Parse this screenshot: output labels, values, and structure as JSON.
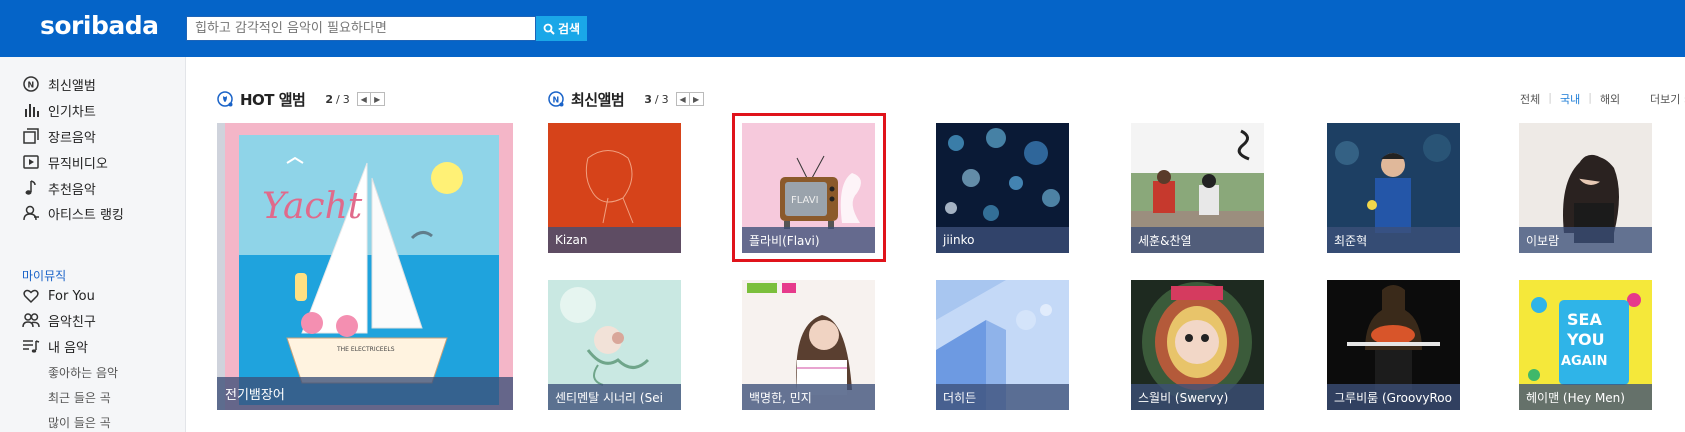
{
  "header": {
    "logo": "soribada",
    "search_placeholder": "힙하고 감각적인 음악이 필요하다면",
    "search_button": "검색"
  },
  "sidebar": {
    "items": [
      {
        "label": "최신앨범",
        "icon": "new-album-icon"
      },
      {
        "label": "인기차트",
        "icon": "chart-icon"
      },
      {
        "label": "장르음악",
        "icon": "genre-icon"
      },
      {
        "label": "뮤직비디오",
        "icon": "video-icon"
      },
      {
        "label": "추천음악",
        "icon": "music-note-icon"
      },
      {
        "label": "아티스트 랭킹",
        "icon": "artist-icon"
      }
    ],
    "my_music_title": "마이뮤직",
    "my_items": [
      {
        "label": "For You",
        "icon": "heart-icon"
      },
      {
        "label": "음악친구",
        "icon": "friends-icon"
      },
      {
        "label": "내 음악",
        "icon": "playlist-icon"
      }
    ],
    "sub_items": [
      "좋아하는 음악",
      "최근 들은 곡",
      "많이 들은 곡"
    ]
  },
  "hot": {
    "title": "HOT 앨범",
    "page_current": "2",
    "page_total": "3",
    "album": "전기뱀장어",
    "cover_title": "Yacht",
    "cover_band": "THE ELECTRICEELS"
  },
  "latest": {
    "title": "최신앨범",
    "page_current": "3",
    "page_total": "3",
    "filters": [
      "전체",
      "국내",
      "해외"
    ],
    "active_filter": "국내",
    "more": "더보기 ›",
    "albums": [
      {
        "label": "Kizan"
      },
      {
        "label": "플라비(Flavi)",
        "cover_text": "FLAVI"
      },
      {
        "label": "jiinko"
      },
      {
        "label": "세훈&찬열"
      },
      {
        "label": "최준혁"
      },
      {
        "label": "이보람"
      },
      {
        "label": "센티멘탈 시너리 (Sei"
      },
      {
        "label": "백명한, 민지"
      },
      {
        "label": "더히든"
      },
      {
        "label": "스월비 (Swervy)"
      },
      {
        "label": "그루비룸 (GroovyRoo"
      },
      {
        "label": "헤이맨 (Hey Men)"
      }
    ]
  }
}
